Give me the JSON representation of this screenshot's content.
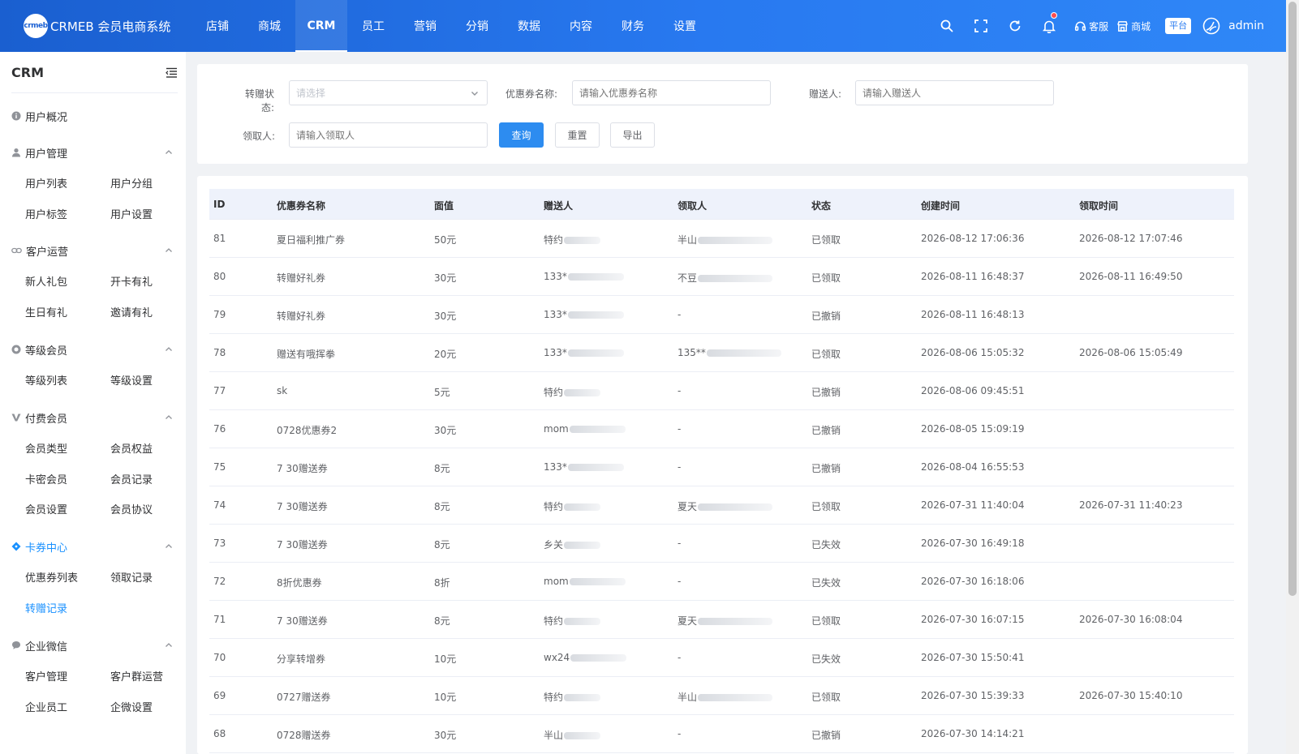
{
  "header": {
    "logo_mark": "crmeb",
    "logo_text": "CRMEB 会员电商系统",
    "nav": [
      "店铺",
      "商城",
      "CRM",
      "员工",
      "营销",
      "分销",
      "数据",
      "内容",
      "财务",
      "设置"
    ],
    "active_nav": "CRM",
    "service_label": "客服",
    "mall_label": "商城",
    "platform_label": "平台",
    "admin_name": "admin",
    "accent_color": "#2879f0"
  },
  "sidebar": {
    "title": "CRM",
    "overview": "用户概况",
    "groups": [
      {
        "label": "用户管理",
        "items": [
          "用户列表",
          "用户分组",
          "用户标签",
          "用户设置"
        ]
      },
      {
        "label": "客户运营",
        "items": [
          "新人礼包",
          "开卡有礼",
          "生日有礼",
          "邀请有礼"
        ]
      },
      {
        "label": "等级会员",
        "items": [
          "等级列表",
          "等级设置"
        ]
      },
      {
        "label": "付费会员",
        "items": [
          "会员类型",
          "会员权益",
          "卡密会员",
          "会员记录",
          "会员设置",
          "会员协议"
        ]
      },
      {
        "label": "卡券中心",
        "items": [
          "优惠券列表",
          "领取记录",
          "转赠记录"
        ]
      },
      {
        "label": "企业微信",
        "items": [
          "客户管理",
          "客户群运营",
          "企业员工",
          "企微设置"
        ]
      }
    ],
    "active_group": "卡券中心",
    "active_item": "转赠记录",
    "active_color": "#1890ff"
  },
  "filters": {
    "status_label": "转赠状态:",
    "status_placeholder": "请选择",
    "coupon_label": "优惠券名称:",
    "coupon_placeholder": "请输入优惠券名称",
    "giver_label": "赠送人:",
    "giver_placeholder": "请输入赠送人",
    "receiver_label": "领取人:",
    "receiver_placeholder": "请输入领取人",
    "search_btn": "查询",
    "reset_btn": "重置",
    "export_btn": "导出"
  },
  "table": {
    "columns": [
      "ID",
      "优惠券名称",
      "面值",
      "赠送人",
      "领取人",
      "状态",
      "创建时间",
      "领取时间"
    ],
    "rows": [
      {
        "id": "81",
        "name": "夏日福利推广券",
        "value": "50元",
        "giver": "特约",
        "receiver": "半山",
        "status": "已领取",
        "created": "2026-08-12 17:06:36",
        "received": "2026-08-12 17:07:46"
      },
      {
        "id": "80",
        "name": "转赠好礼券",
        "value": "30元",
        "giver": "133*",
        "receiver": "不豆",
        "status": "已领取",
        "created": "2026-08-11 16:48:37",
        "received": "2026-08-11 16:49:50"
      },
      {
        "id": "79",
        "name": "转赠好礼券",
        "value": "30元",
        "giver": "133*",
        "receiver": "-",
        "status": "已撤销",
        "created": "2026-08-11 16:48:13",
        "received": ""
      },
      {
        "id": "78",
        "name": "赠送有哦挥拳",
        "value": "20元",
        "giver": "133*",
        "receiver": "135**",
        "status": "已领取",
        "created": "2026-08-06 15:05:32",
        "received": "2026-08-06 15:05:49"
      },
      {
        "id": "77",
        "name": "sk",
        "value": "5元",
        "giver": "特约",
        "receiver": "-",
        "status": "已撤销",
        "created": "2026-08-06 09:45:51",
        "received": ""
      },
      {
        "id": "76",
        "name": "0728优惠券2",
        "value": "30元",
        "giver": "mom",
        "receiver": "-",
        "status": "已撤销",
        "created": "2026-08-05 15:09:19",
        "received": ""
      },
      {
        "id": "75",
        "name": "7 30赠送券",
        "value": "8元",
        "giver": "133*",
        "receiver": "-",
        "status": "已撤销",
        "created": "2026-08-04 16:55:53",
        "received": ""
      },
      {
        "id": "74",
        "name": "7 30赠送券",
        "value": "8元",
        "giver": "特约",
        "receiver": "夏天",
        "status": "已领取",
        "created": "2026-07-31 11:40:04",
        "received": "2026-07-31 11:40:23"
      },
      {
        "id": "73",
        "name": "7 30赠送券",
        "value": "8元",
        "giver": "乡关",
        "receiver": "-",
        "status": "已失效",
        "created": "2026-07-30 16:49:18",
        "received": ""
      },
      {
        "id": "72",
        "name": "8折优惠券",
        "value": "8折",
        "giver": "mom",
        "receiver": "-",
        "status": "已失效",
        "created": "2026-07-30 16:18:06",
        "received": ""
      },
      {
        "id": "71",
        "name": "7 30赠送券",
        "value": "8元",
        "giver": "特约",
        "receiver": "夏天",
        "status": "已领取",
        "created": "2026-07-30 16:07:15",
        "received": "2026-07-30 16:08:04"
      },
      {
        "id": "70",
        "name": "分享转增券",
        "value": "10元",
        "giver": "wx24",
        "receiver": "-",
        "status": "已失效",
        "created": "2026-07-30 15:50:41",
        "received": ""
      },
      {
        "id": "69",
        "name": "0727赠送券",
        "value": "10元",
        "giver": "特约",
        "receiver": "半山",
        "status": "已领取",
        "created": "2026-07-30 15:39:33",
        "received": "2026-07-30 15:40:10"
      },
      {
        "id": "68",
        "name": "0728赠送券",
        "value": "30元",
        "giver": "半山",
        "receiver": "-",
        "status": "已撤销",
        "created": "2026-07-30 14:14:21",
        "received": ""
      }
    ]
  }
}
